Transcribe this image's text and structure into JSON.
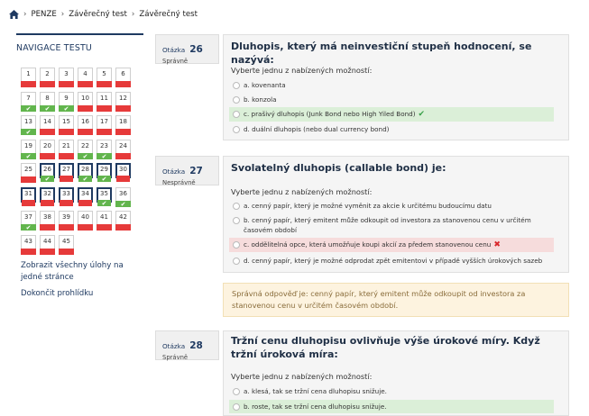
{
  "breadcrumb": {
    "items": [
      "PENZE",
      "Závěrečný test",
      "Závěrečný test"
    ]
  },
  "nav": {
    "title": "NAVIGACE TESTU",
    "questions": [
      {
        "n": "1",
        "s": "wrong"
      },
      {
        "n": "2",
        "s": "wrong"
      },
      {
        "n": "3",
        "s": "wrong"
      },
      {
        "n": "4",
        "s": "wrong"
      },
      {
        "n": "5",
        "s": "wrong"
      },
      {
        "n": "6",
        "s": "wrong"
      },
      {
        "n": "7",
        "s": "correct"
      },
      {
        "n": "8",
        "s": "correct"
      },
      {
        "n": "9",
        "s": "correct"
      },
      {
        "n": "10",
        "s": "wrong"
      },
      {
        "n": "11",
        "s": "wrong"
      },
      {
        "n": "12",
        "s": "wrong"
      },
      {
        "n": "13",
        "s": "correct"
      },
      {
        "n": "14",
        "s": "wrong"
      },
      {
        "n": "15",
        "s": "wrong"
      },
      {
        "n": "16",
        "s": "wrong"
      },
      {
        "n": "17",
        "s": "wrong"
      },
      {
        "n": "18",
        "s": "wrong"
      },
      {
        "n": "19",
        "s": "correct"
      },
      {
        "n": "20",
        "s": "wrong"
      },
      {
        "n": "21",
        "s": "wrong"
      },
      {
        "n": "22",
        "s": "correct"
      },
      {
        "n": "23",
        "s": "correct"
      },
      {
        "n": "24",
        "s": "wrong"
      },
      {
        "n": "25",
        "s": "wrong"
      },
      {
        "n": "26",
        "s": "correct",
        "cur": true
      },
      {
        "n": "27",
        "s": "wrong",
        "cur": true
      },
      {
        "n": "28",
        "s": "correct",
        "cur": true
      },
      {
        "n": "29",
        "s": "correct",
        "cur": true
      },
      {
        "n": "30",
        "s": "wrong",
        "cur": true
      },
      {
        "n": "31",
        "s": "wrong",
        "cur": true
      },
      {
        "n": "32",
        "s": "wrong",
        "cur": true
      },
      {
        "n": "33",
        "s": "wrong",
        "cur": true
      },
      {
        "n": "34",
        "s": "wrong",
        "cur": true
      },
      {
        "n": "35",
        "s": "correct",
        "cur": true
      },
      {
        "n": "36",
        "s": "correct"
      },
      {
        "n": "37",
        "s": "correct"
      },
      {
        "n": "38",
        "s": "wrong"
      },
      {
        "n": "39",
        "s": "wrong"
      },
      {
        "n": "40",
        "s": "wrong"
      },
      {
        "n": "41",
        "s": "wrong"
      },
      {
        "n": "42",
        "s": "wrong"
      },
      {
        "n": "43",
        "s": "wrong"
      },
      {
        "n": "44",
        "s": "wrong"
      },
      {
        "n": "45",
        "s": "wrong"
      }
    ],
    "show_all": "Zobrazit všechny úlohy na jedné stránce",
    "finish": "Dokončit prohlídku"
  },
  "q26": {
    "label": "Otázka",
    "number": "26",
    "status": "Správně",
    "text": "Dluhopis, který má neinvestiční stupeň hodnocení, se nazývá:",
    "prompt": "Vyberte jednu z nabízených možností:",
    "answers": [
      "a. kovenanta",
      "b. konzola",
      "c. prašivý dluhopis (Junk Bond nebo High Yiled Bond)",
      "d. duální dluhopis (nebo dual currency bond)"
    ]
  },
  "q27": {
    "label": "Otázka",
    "number": "27",
    "status": "Nesprávně",
    "text": "Svolatelný dluhopis (callable bond) je:",
    "prompt": "Vyberte jednu z nabízených možností:",
    "answers": [
      "a. cenný papír, který je možné vyměnit za akcie k určitému budoucímu datu",
      "b. cenný papír, který emitent může odkoupit od investora za stanovenou cenu v určitém časovém období",
      "c. oddělitelná opce, která umožňuje koupi akcií za předem stanovenou cenu",
      "d. cenný papír, který je možné odprodat zpět emitentovi v případě vyšších úrokových sazeb"
    ],
    "feedback": "Správná odpověď je: cenný papír, který emitent může odkoupit od investora za stanovenou cenu v určitém časovém období."
  },
  "q28": {
    "label": "Otázka",
    "number": "28",
    "status": "Správně",
    "text": "Tržní cenu dluhopisu ovlivňuje výše úrokové míry. Když tržní úroková míra:",
    "prompt": "Vyberte jednu z nabízených možností:",
    "answers": [
      "a. klesá, tak se tržní cena dluhopisu snižuje.",
      "b. roste, tak se tržní cena dluhopisu snižuje."
    ]
  }
}
